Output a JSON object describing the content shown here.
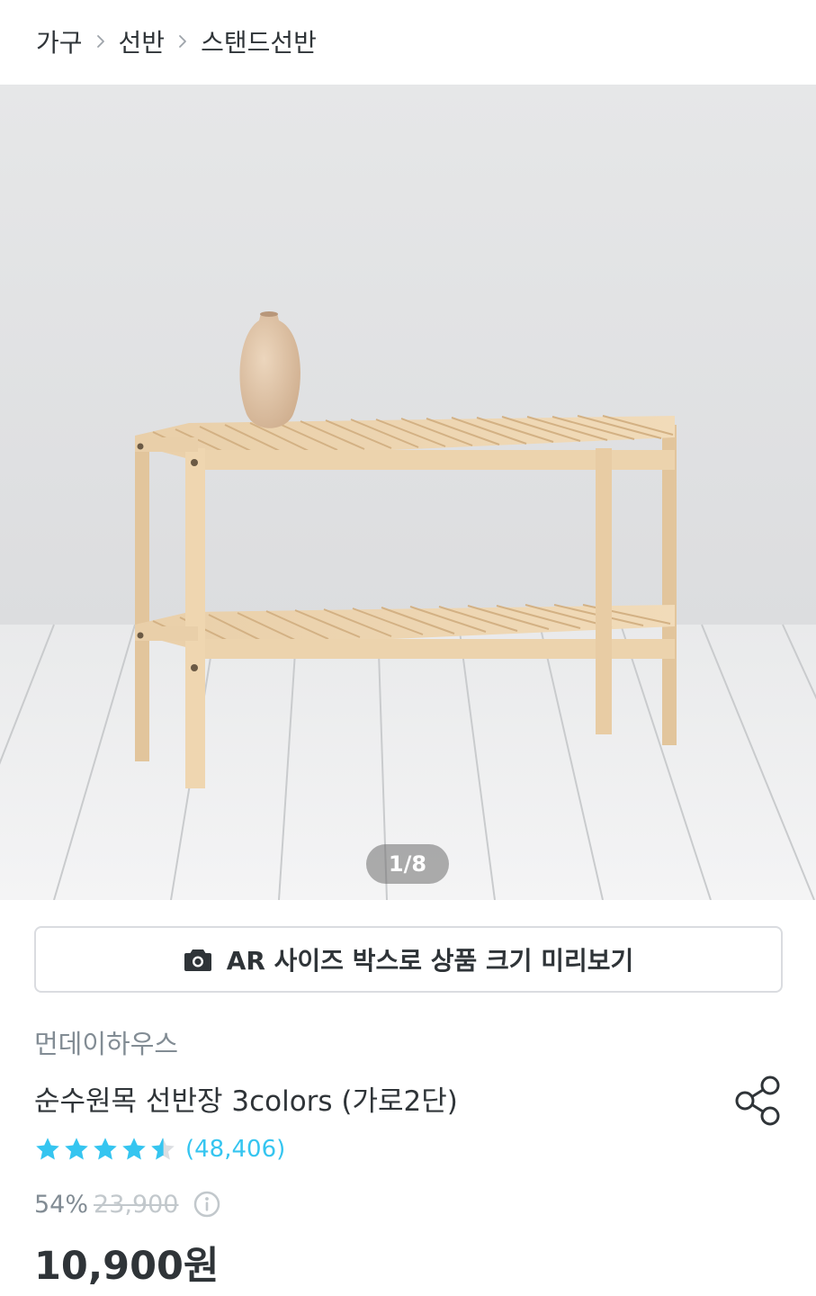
{
  "breadcrumb": {
    "items": [
      "가구",
      "선반",
      "스탠드선반"
    ]
  },
  "gallery": {
    "page_indicator": "1/8",
    "current_page": 1,
    "total_pages": 8
  },
  "ar_button": {
    "icon": "camera-icon",
    "label": "AR 사이즈 박스로 상품 크기 미리보기"
  },
  "product": {
    "brand": "먼데이하우스",
    "title": "순수원목 선반장 3colors (가로2단)",
    "rating": 4.5,
    "review_count": "(48,406)",
    "discount": "54%",
    "original_price": "23,900",
    "price": "10,900원"
  },
  "colors": {
    "accent": "#35c5f0",
    "text_primary": "#2f3438",
    "text_secondary": "#828c94",
    "strikethrough": "#c2c8cc"
  }
}
